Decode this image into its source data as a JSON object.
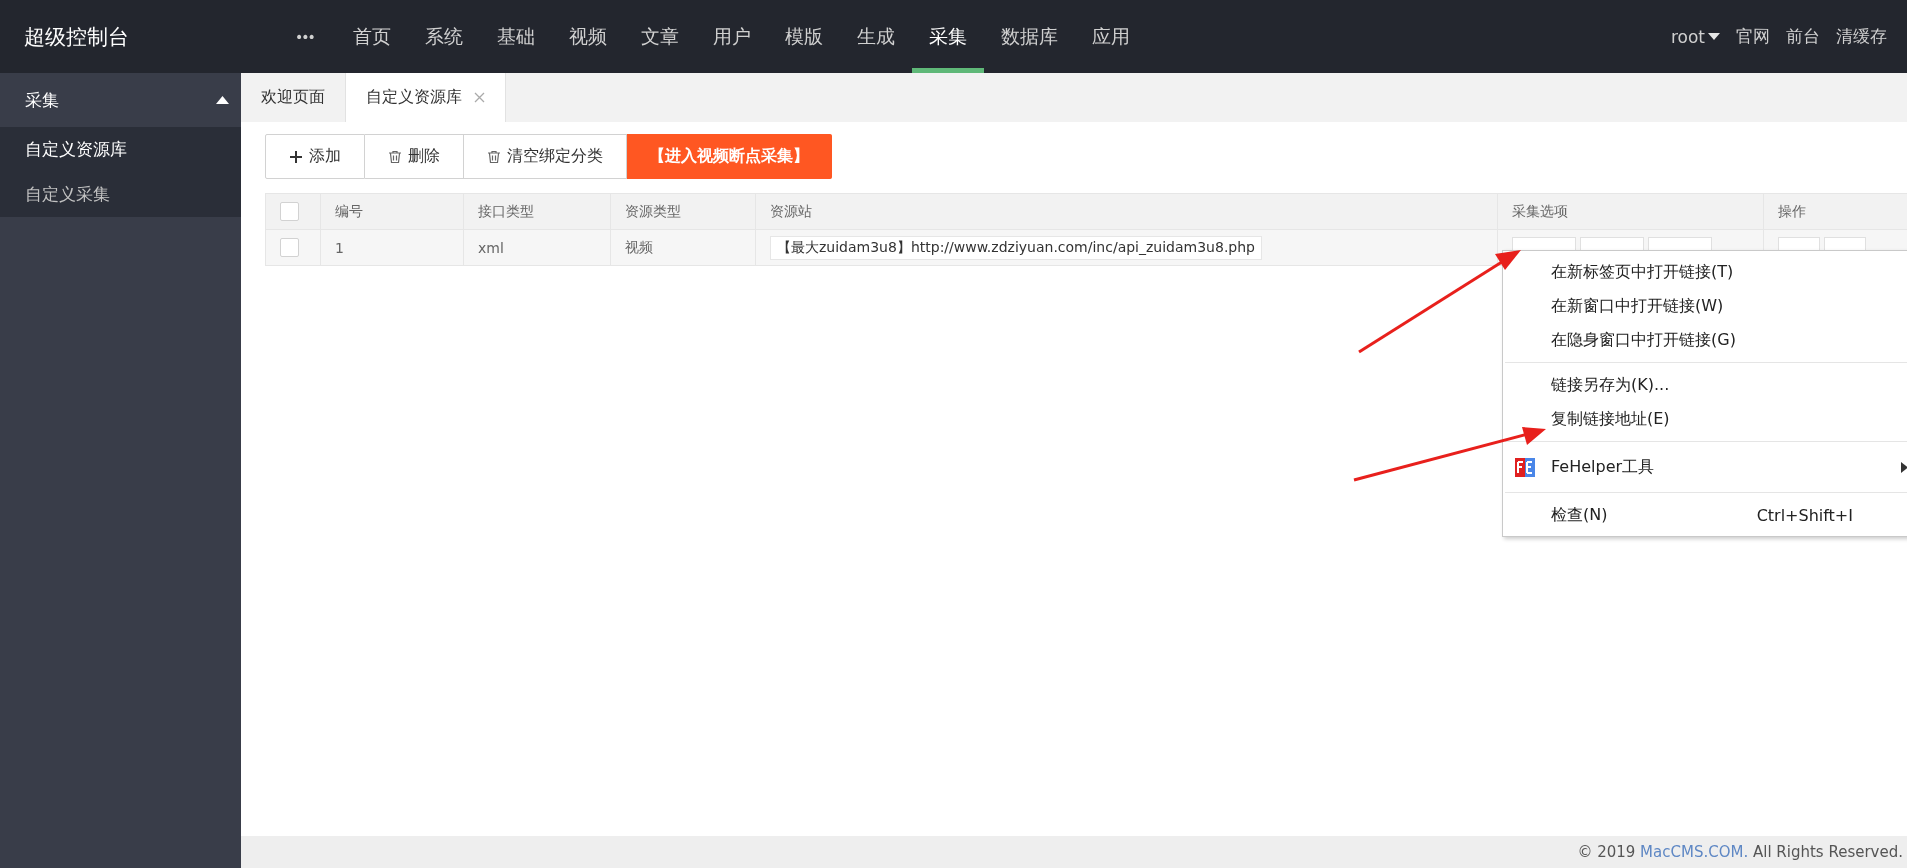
{
  "header": {
    "title": "超级控制台",
    "more": "•••",
    "nav": [
      {
        "label": "首页",
        "selected": false
      },
      {
        "label": "系统",
        "selected": false
      },
      {
        "label": "基础",
        "selected": false
      },
      {
        "label": "视频",
        "selected": false
      },
      {
        "label": "文章",
        "selected": false
      },
      {
        "label": "用户",
        "selected": false
      },
      {
        "label": "模版",
        "selected": false
      },
      {
        "label": "生成",
        "selected": false
      },
      {
        "label": "采集",
        "selected": true
      },
      {
        "label": "数据库",
        "selected": false
      },
      {
        "label": "应用",
        "selected": false
      }
    ],
    "user": "root",
    "links": [
      "官网",
      "前台",
      "清缓存"
    ]
  },
  "sidebar": {
    "section": {
      "label": "采集",
      "expanded": true
    },
    "items": [
      {
        "label": "自定义资源库",
        "selected": true
      },
      {
        "label": "自定义采集",
        "selected": false
      }
    ]
  },
  "tabs": [
    {
      "label": "欢迎页面",
      "selected": false,
      "closable": false
    },
    {
      "label": "自定义资源库",
      "selected": true,
      "closable": true
    }
  ],
  "toolbar": [
    {
      "label": "添加",
      "kind": "add"
    },
    {
      "label": "删除",
      "kind": "delete"
    },
    {
      "label": "清空绑定分类",
      "kind": "delete"
    },
    {
      "label": "【进入视频断点采集】",
      "kind": "primary"
    }
  ],
  "table": {
    "all_checked": false,
    "columns": [
      "编号",
      "接口类型",
      "资源类型",
      "资源站",
      "采集选项",
      "操作"
    ],
    "rows": [
      {
        "checked": false,
        "id": "1",
        "api_type": "xml",
        "resource_type": "视频",
        "site": "【最大zuidam3u8】http://www.zdziyuan.com/inc/api_zuidam3u8.php",
        "collect_options": [
          {
            "kind": "button"
          },
          {
            "kind": "button"
          },
          {
            "kind": "button"
          }
        ],
        "actions": [
          {
            "kind": "button"
          },
          {
            "kind": "button"
          }
        ]
      }
    ]
  },
  "context_menu": [
    {
      "kind": "item",
      "label": "在新标签页中打开链接(T)"
    },
    {
      "kind": "item",
      "label": "在新窗口中打开链接(W)"
    },
    {
      "kind": "item",
      "label": "在隐身窗口中打开链接(G)"
    },
    {
      "kind": "separator"
    },
    {
      "kind": "item",
      "label": "链接另存为(K)..."
    },
    {
      "kind": "item",
      "label": "复制链接地址(E)"
    },
    {
      "kind": "separator"
    },
    {
      "kind": "submenu",
      "label": "FeHelper工具"
    },
    {
      "kind": "separator"
    },
    {
      "kind": "item",
      "label": "检查(N)",
      "shortcut": "Ctrl+Shift+I"
    }
  ],
  "footer": {
    "prefix": "© 2019 ",
    "link": "MacCMS.COM.",
    "suffix": " All Rights Reserved."
  }
}
